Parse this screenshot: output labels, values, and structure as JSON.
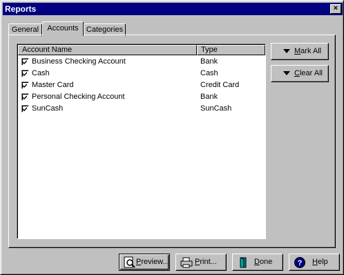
{
  "window": {
    "title": "Reports",
    "close_label": "×"
  },
  "tabs": [
    {
      "label": "General"
    },
    {
      "label": "Accounts"
    },
    {
      "label": "Categories"
    }
  ],
  "list": {
    "columns": {
      "name": "Account Name",
      "type": "Type"
    },
    "rows": [
      {
        "name": "Business Checking Account",
        "type": "Bank",
        "checked": true
      },
      {
        "name": "Cash",
        "type": "Cash",
        "checked": true
      },
      {
        "name": "Master Card",
        "type": "Credit Card",
        "checked": true
      },
      {
        "name": "Personal Checking Account",
        "type": "Bank",
        "checked": true
      },
      {
        "name": "SunCash",
        "type": "SunCash",
        "checked": true
      }
    ]
  },
  "side_buttons": {
    "mark_all": {
      "mnemonic": "M",
      "rest": "ark All"
    },
    "clear_all": {
      "mnemonic": "C",
      "rest": "lear All"
    }
  },
  "bottom_buttons": {
    "preview": {
      "mnemonic": "P",
      "rest": "review..."
    },
    "print": {
      "mnemonic": "P",
      "rest": "rint..."
    },
    "done": {
      "mnemonic": "D",
      "rest": "one"
    },
    "help": {
      "mnemonic": "H",
      "rest": "elp"
    }
  },
  "colors": {
    "titlebar": "#000080",
    "face": "#c0c0c0"
  }
}
